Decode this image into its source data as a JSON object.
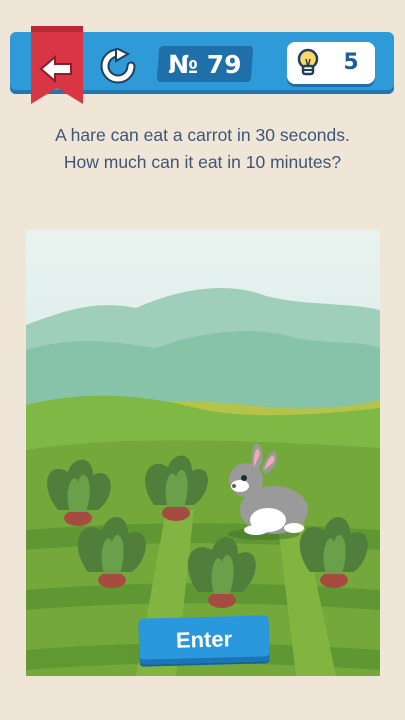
{
  "header": {
    "level_text": "№ 79",
    "hint_count": "5",
    "back_icon": "back-arrow-icon",
    "restart_icon": "restart-icon",
    "hint_icon": "lightbulb-icon"
  },
  "question": {
    "line1": "A hare can eat a carrot in 30 seconds.",
    "line2": "How much can it eat in 10 minutes?"
  },
  "scene": {
    "description_items": [
      "hare",
      "carrot plants",
      "field"
    ]
  },
  "actions": {
    "enter_label": "Enter"
  },
  "colors": {
    "bar_blue": "#2f9ad8",
    "ribbon_red": "#d93645",
    "text_navy": "#3f5575",
    "background": "#efe6d8"
  }
}
